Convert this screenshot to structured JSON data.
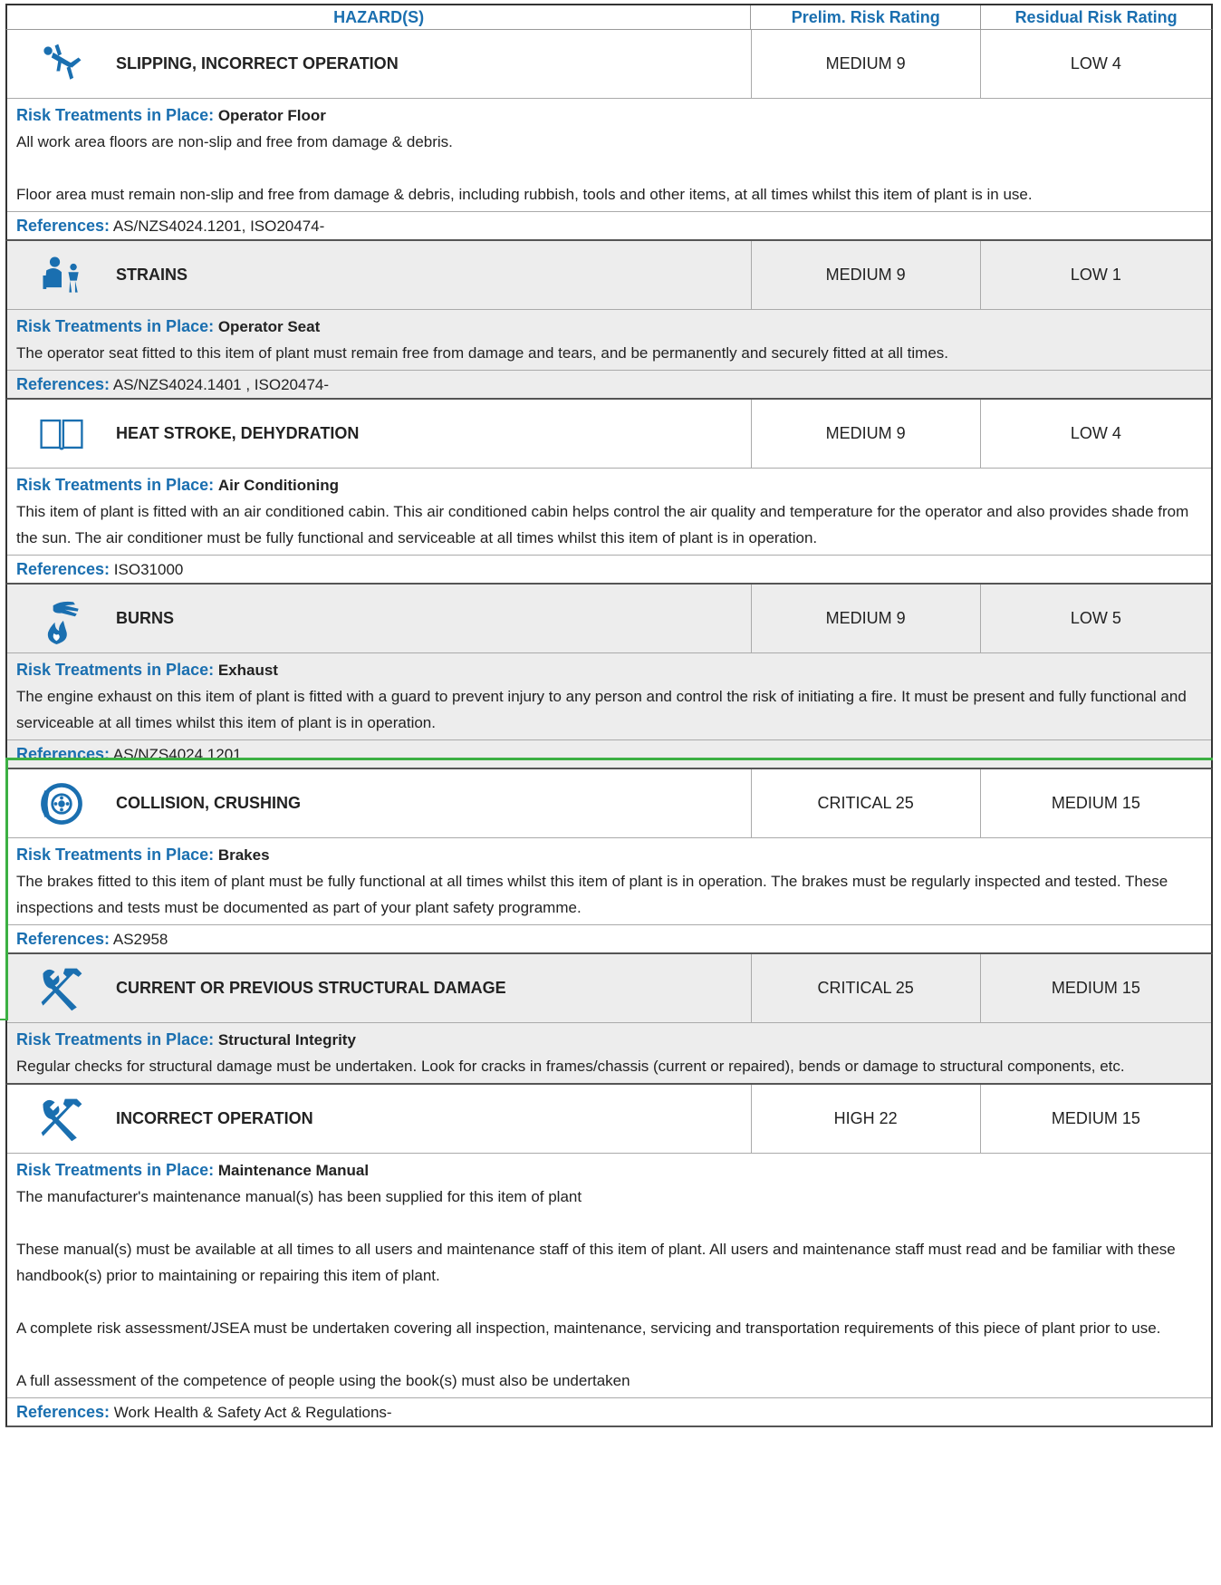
{
  "header": {
    "hazard": "HAZARD(S)",
    "prelim": "Prelim. Risk Rating",
    "residual": "Residual Risk Rating"
  },
  "labels": {
    "treatments": "Risk Treatments in Place:",
    "references": "References:"
  },
  "colors": {
    "accent": "#1a6fb0",
    "highlight": "#3cb043",
    "alt_row": "#ededed"
  },
  "hazards": [
    {
      "icon": "falling-person-icon",
      "name": "SLIPPING, INCORRECT OPERATION",
      "prelim": "MEDIUM 9",
      "residual": "LOW 4",
      "treatment": "Operator Floor",
      "paragraphs": [
        "All work area floors are non-slip and free from damage & debris.",
        "",
        "Floor area must remain non-slip and free from damage & debris, including rubbish, tools and other items, at all times whilst this item of plant is in use."
      ],
      "references": "AS/NZS4024.1201, ISO20474-"
    },
    {
      "icon": "strain-person-icon",
      "name": "STRAINS",
      "prelim": "MEDIUM 9",
      "residual": "LOW 1",
      "treatment": "Operator Seat",
      "paragraphs": [
        "The operator seat fitted to this item of plant must remain free from damage and tears, and be permanently and securely fitted at all times."
      ],
      "references": "AS/NZS4024.1401 , ISO20474-"
    },
    {
      "icon": "open-book-icon",
      "name": "HEAT STROKE, DEHYDRATION",
      "prelim": "MEDIUM 9",
      "residual": "LOW 4",
      "treatment": "Air Conditioning",
      "paragraphs": [
        "This item of plant is fitted with an air conditioned cabin. This air conditioned cabin helps control the air quality and temperature for the operator and also provides shade from the sun. The air conditioner must be fully functional and serviceable at all times whilst this item of plant is in operation."
      ],
      "references": "ISO31000"
    },
    {
      "icon": "hand-flame-icon",
      "name": "BURNS",
      "prelim": "MEDIUM 9",
      "residual": "LOW 5",
      "treatment": "Exhaust",
      "paragraphs": [
        "The engine exhaust on this item of plant is fitted with a guard to prevent injury to any person and control the risk of initiating a fire. It must be present and fully functional and serviceable at all times whilst this item of plant is in operation."
      ],
      "references": "AS/NZS4024.1201"
    },
    {
      "icon": "brake-disc-icon",
      "name": "COLLISION, CRUSHING",
      "prelim": "CRITICAL 25",
      "residual": "MEDIUM 15",
      "treatment": "Brakes",
      "paragraphs": [
        "The brakes fitted to this item of plant must be fully functional at all times whilst this item of plant is in operation. The brakes must be regularly inspected and tested. These inspections and tests must be documented as part of your plant safety programme."
      ],
      "references": "AS2958"
    },
    {
      "icon": "wrench-hammer-icon",
      "name": "CURRENT OR PREVIOUS STRUCTURAL DAMAGE",
      "prelim": "CRITICAL 25",
      "residual": "MEDIUM 15",
      "treatment": "Structural Integrity",
      "paragraphs": [
        "Regular checks for structural damage must be undertaken. Look for cracks in frames/chassis (current or repaired), bends or damage to structural components, etc."
      ],
      "references": ""
    },
    {
      "icon": "wrench-hammer-icon",
      "name": "INCORRECT OPERATION",
      "prelim": "HIGH 22",
      "residual": "MEDIUM 15",
      "treatment": "Maintenance Manual",
      "paragraphs": [
        "The manufacturer's maintenance manual(s) has been supplied for this item of plant",
        "",
        "These manual(s) must be available at all times to all users and maintenance staff of this item of plant. All users and maintenance staff must read and be familiar with these handbook(s) prior to maintaining or repairing this item of plant.",
        "",
        "A complete risk assessment/JSEA must be undertaken covering all inspection, maintenance, servicing and transportation requirements of this piece of plant prior to use.",
        "",
        "A full assessment of the competence of people using the book(s) must also be undertaken"
      ],
      "references": "Work Health & Safety Act & Regulations-"
    }
  ]
}
